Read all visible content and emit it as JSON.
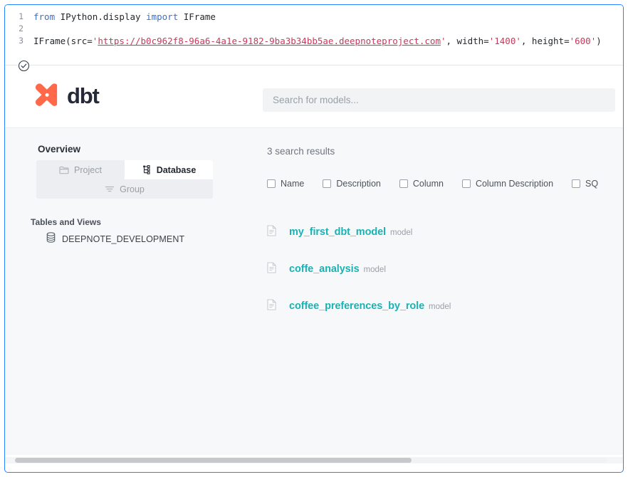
{
  "notebook_cell": {
    "run_status_icon": "check-circle-icon",
    "code_lines": [
      {
        "number": "1",
        "tokens": [
          {
            "t": "kw",
            "v": "from "
          },
          {
            "t": "def",
            "v": "IPython.display "
          },
          {
            "t": "kw",
            "v": "import "
          },
          {
            "t": "def",
            "v": "IFrame"
          }
        ]
      },
      {
        "number": "2",
        "tokens": []
      },
      {
        "number": "3",
        "tokens": [
          {
            "t": "def",
            "v": "IFrame(src="
          },
          {
            "t": "str",
            "v": "'"
          },
          {
            "t": "url",
            "v": "https://b0c962f8-96a6-4a1e-9182-9ba3b34bb5ae.deepnoteproject.com"
          },
          {
            "t": "str",
            "v": "'"
          },
          {
            "t": "def",
            "v": ", width="
          },
          {
            "t": "str",
            "v": "'1400'"
          },
          {
            "t": "def",
            "v": ", height="
          },
          {
            "t": "str",
            "v": "'600'"
          },
          {
            "t": "def",
            "v": ")"
          }
        ]
      }
    ]
  },
  "dbt_docs": {
    "header": {
      "logo_mark": "dbt-logo-icon",
      "wordmark": "dbt",
      "search": {
        "placeholder": "Search for models...",
        "value": ""
      }
    },
    "sidebar": {
      "title": "Overview",
      "tabs": [
        {
          "label": "Project",
          "icon": "folder-icon",
          "active": false
        },
        {
          "label": "Database",
          "icon": "tree-hierarchy-icon",
          "active": true
        },
        {
          "label": "Group",
          "icon": "filter-lines-icon",
          "active": false
        }
      ],
      "section_label": "Tables and Views",
      "nodes": [
        {
          "label": "DEEPNOTE_DEVELOPMENT",
          "icon": "database-icon"
        }
      ]
    },
    "results": {
      "count_label": "3 search results",
      "filters": [
        {
          "label": "Name",
          "checked": false
        },
        {
          "label": "Description",
          "checked": false
        },
        {
          "label": "Column",
          "checked": false
        },
        {
          "label": "Column Description",
          "checked": false
        },
        {
          "label": "SQ",
          "checked": false
        }
      ],
      "items": [
        {
          "name": "my_first_dbt_model",
          "kind": "model",
          "icon": "document-icon"
        },
        {
          "name": "coffe_analysis",
          "kind": "model",
          "icon": "document-icon"
        },
        {
          "name": "coffee_preferences_by_role",
          "kind": "model",
          "icon": "document-icon"
        }
      ]
    },
    "colors": {
      "accent_teal": "#19B3B5",
      "dbt_orange": "#FF694A",
      "dbt_navy": "#262A38",
      "cell_focus_blue": "#2684FF",
      "body_bg": "#F7F8FA"
    }
  }
}
